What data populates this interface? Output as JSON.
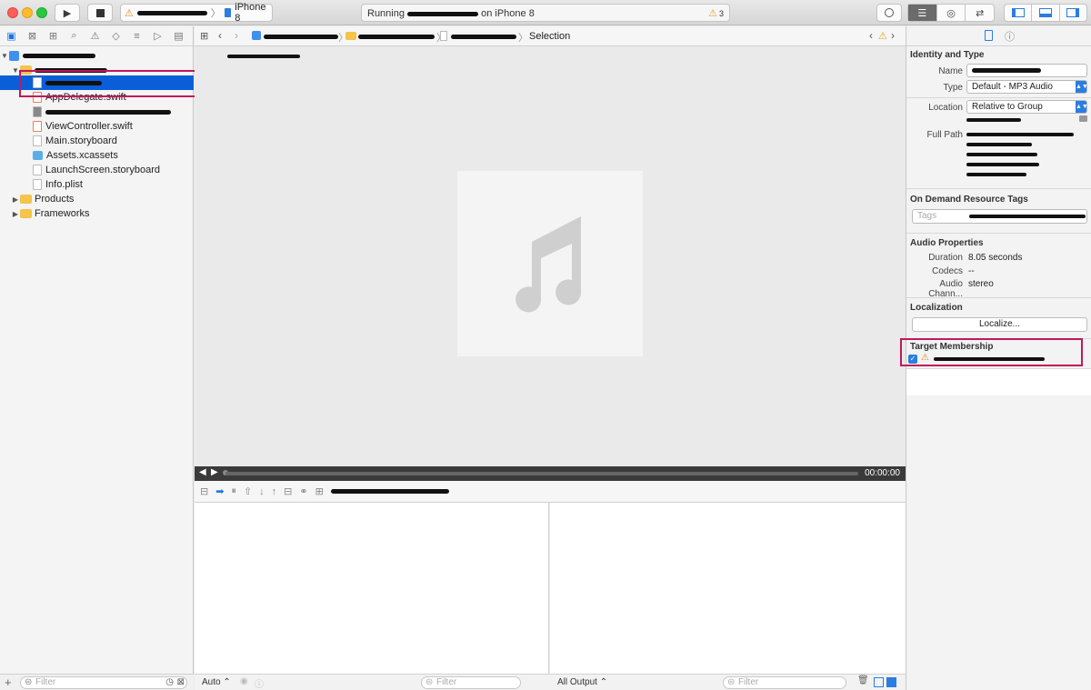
{
  "toolbar": {
    "device": "iPhone 8",
    "activity_status": "Running",
    "activity_target": "on iPhone 8",
    "warning_count": "3"
  },
  "navigator": {
    "items": [
      {
        "label": "AppDelegate.swift"
      },
      {
        "label": "ViewController.swift"
      },
      {
        "label": "Main.storyboard"
      },
      {
        "label": "Assets.xcassets"
      },
      {
        "label": "LaunchScreen.storyboard"
      },
      {
        "label": "Info.plist"
      },
      {
        "label": "Products"
      },
      {
        "label": "Frameworks"
      }
    ],
    "filter_placeholder": "Filter"
  },
  "jumpbar": {
    "last_crumb": "Selection"
  },
  "player": {
    "time": "00:00:00"
  },
  "debug": {
    "auto_label": "Auto ⌃",
    "filter_placeholder": "Filter",
    "all_output_label": "All Output ⌃",
    "console_filter_placeholder": "Filter"
  },
  "inspector": {
    "identity_title": "Identity and Type",
    "name_label": "Name",
    "type_label": "Type",
    "type_value": "Default - MP3 Audio",
    "location_label": "Location",
    "location_value": "Relative to Group",
    "fullpath_label": "Full Path",
    "ondemand_title": "On Demand Resource Tags",
    "tags_placeholder": "Tags",
    "audio_title": "Audio Properties",
    "duration_label": "Duration",
    "duration_value": "8.05 seconds",
    "codecs_label": "Codecs",
    "codecs_value": "--",
    "channels_label": "Audio Chann...",
    "channels_value": "stereo",
    "localization_title": "Localization",
    "localize_button": "Localize...",
    "target_title": "Target Membership"
  }
}
